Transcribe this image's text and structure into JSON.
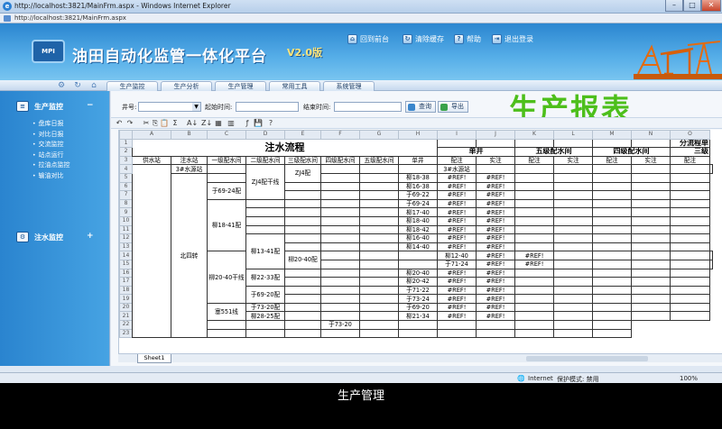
{
  "window": {
    "title": "http://localhost:3821/MainFrm.aspx - Windows Internet Explorer",
    "address": "http://localhost:3821/MainFrm.aspx",
    "buttons": [
      "–",
      "□",
      "✕"
    ]
  },
  "header": {
    "logo_text": "MPI",
    "title": "油田自动化监管一体化平台",
    "version": "V2.0版",
    "links": [
      "回到前台",
      "清除缓存",
      "帮助",
      "退出登录"
    ]
  },
  "nav": {
    "tabs": [
      "生产监控",
      "生产分析",
      "生产管理",
      "常用工具",
      "系统管理"
    ]
  },
  "sidebar": {
    "sections": [
      {
        "title": "生产监控",
        "toggle": "−",
        "items": [
          "盘库日报",
          "对比日报",
          "交流监控",
          "站点运行",
          "拉油点监控",
          "输油对比"
        ]
      },
      {
        "title": "注水监控",
        "toggle": "+"
      }
    ]
  },
  "filter": {
    "well_label": "井号:",
    "start_label": "起始时间:",
    "end_label": "结束时间:",
    "query_button": "查询",
    "export_button": "导出"
  },
  "banner": "生产报表",
  "toolbar": {
    "icons": [
      "undo-icon",
      "redo-icon",
      "cut-icon",
      "copy-icon",
      "paste-icon",
      "sum-icon",
      "sort-asc-icon",
      "sort-desc-icon",
      "format-icon",
      "chart-icon",
      "function-icon",
      "save-icon",
      "help-icon"
    ],
    "glyphs": [
      "↶",
      "↷",
      "✂",
      "⎘",
      "📋",
      "Σ",
      "A↓",
      "Z↓",
      "▦",
      "▥",
      "ƒ",
      "💾",
      "?"
    ]
  },
  "sheet": {
    "columns": [
      "A",
      "B",
      "C",
      "D",
      "E",
      "F",
      "G",
      "H",
      "I",
      "J",
      "K",
      "L",
      "M",
      "N",
      "O"
    ],
    "row_numbers": [
      "1",
      "2",
      "3",
      "4",
      "5",
      "6",
      "7",
      "8",
      "9",
      "10",
      "11",
      "12",
      "13",
      "14",
      "15",
      "16",
      "17",
      "18",
      "19",
      "20",
      "21",
      "22",
      "23"
    ],
    "title": "注水流程",
    "title_right": "分流程单",
    "group_headers": [
      "单井",
      "五级配水间",
      "四级配水间",
      "三级"
    ],
    "headers": [
      "供水站",
      "注水站",
      "一级配水间",
      "二级配水间",
      "三级配水间",
      "四级配水间",
      "五级配水间",
      "单井"
    ],
    "sub_headers": [
      "配注",
      "实注"
    ],
    "source_station": "3#水源站",
    "north_station": "北四转",
    "level1": [
      "ZJ4配干线",
      "柳18-41配",
      "柳20-40干线",
      "塞551线"
    ],
    "level2": [
      "ZJ4配",
      "于69-24配",
      "柳13-41配",
      "柳20-40配",
      "柳22-33配",
      "于69-20配",
      "于73-20配",
      "柳28-25配"
    ],
    "wells": [
      "柳18-38",
      "柳16-38",
      "于69-22",
      "于69-24",
      "柳17-40",
      "柳18-40",
      "柳18-42",
      "柳16-40",
      "柳14-40",
      "柳12-40",
      "于71-24",
      "柳20-40",
      "柳20-42",
      "于71-22",
      "于73-24",
      "于69-20",
      "柳21-34",
      "于73-20",
      "柳28-25"
    ],
    "ref_error": "#REF!",
    "ref_rows": 17,
    "tab_name": "Sheet1"
  },
  "status": {
    "zone": "Internet",
    "protect": "保护模式: 禁用",
    "zoom": "100%"
  },
  "caption": "生产管理"
}
